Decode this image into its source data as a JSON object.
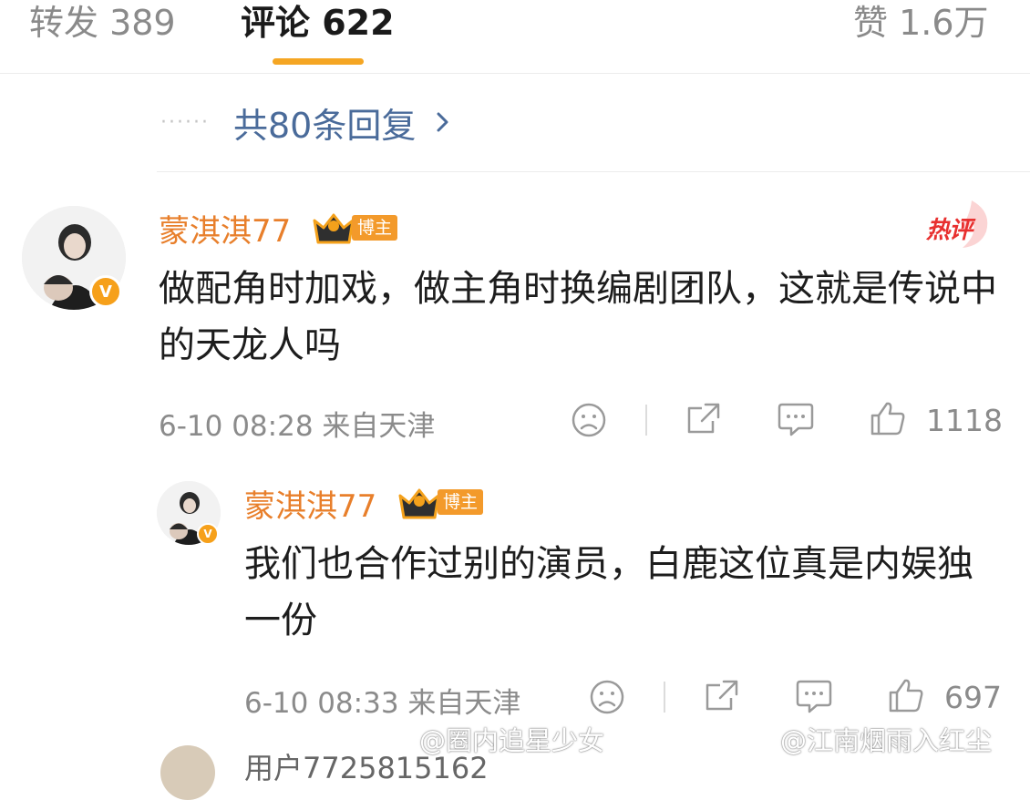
{
  "tabs": {
    "repost": "转发 389",
    "comments": "评论 622",
    "likes": "赞 1.6万"
  },
  "replies_link": {
    "dots": "······",
    "label": "共80条回复"
  },
  "comment": {
    "username": "蒙淇淇77",
    "role_badge": "博主",
    "hot_badge": "热评",
    "text": "做配角时加戏，做主角时换编剧团队，这就是传说中的天龙人吗",
    "time_location": "6-10 08:28 来自天津",
    "like_count": "1118"
  },
  "reply": {
    "username": "蒙淇淇77",
    "role_badge": "博主",
    "text": "我们也合作过别的演员，白鹿这位真是内娱独一份",
    "time_location": "6-10 08:33 来自天津",
    "like_count": "697"
  },
  "next_comment": {
    "username": "用户7725815162"
  },
  "watermarks": {
    "left": "@圈内追星少女",
    "right": "@江南烟雨入红尘"
  },
  "colors": {
    "accent": "#f5a623",
    "username": "#e87f2b",
    "link": "#4a6b9a",
    "hot": "#e8302f"
  },
  "icons": [
    "dislike-face-icon",
    "repost-icon",
    "comment-icon",
    "like-icon",
    "crown-icon",
    "verified-v-icon"
  ]
}
